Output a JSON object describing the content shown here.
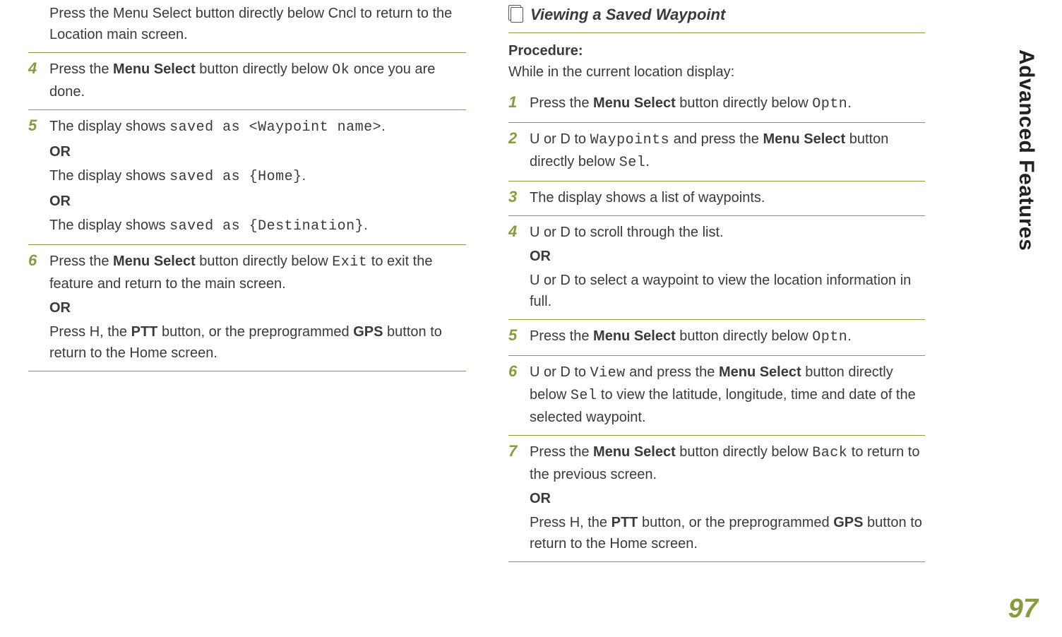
{
  "sideTab": "Advanced Features",
  "pageNumber": "97",
  "left": {
    "intro": {
      "pre": "Press the ",
      "b1": "Menu Select",
      "mid1": " button directly below ",
      "m1": "Cncl",
      "post": " to return to the Location main screen."
    },
    "s4": {
      "num": "4",
      "pre": "Press the ",
      "b1": "Menu Select",
      "mid1": " button directly below ",
      "m1": "Ok",
      "post": " once you are done."
    },
    "s5": {
      "num": "5",
      "l1a": "The display shows ",
      "l1m": "saved as <Waypoint name>",
      "l1b": ".",
      "or1": "OR",
      "l2a": "The display shows ",
      "l2m": "saved as {Home}",
      "l2b": ".",
      "or2": "OR",
      "l3a": "The display shows ",
      "l3m": "saved as {Destination}",
      "l3b": "."
    },
    "s6": {
      "num": "6",
      "pre": "Press the ",
      "b1": "Menu Select",
      "mid1": " button directly below ",
      "m1": "Exit",
      "post": " to exit the feature and return to the main screen.",
      "or": "OR",
      "l2a": "Press ",
      "l2h": "H",
      "l2b": ", the ",
      "l2ptt": "PTT",
      "l2c": " button, or the preprogrammed ",
      "l2gps": "GPS",
      "l2d": " button to return to the Home screen."
    }
  },
  "right": {
    "heading": "Viewing a Saved Waypoint",
    "procLabel": "Procedure:",
    "procText": "While in the current location display:",
    "s1": {
      "num": "1",
      "pre": "Press the ",
      "b1": "Menu Select",
      "mid1": " button directly below ",
      "m1": "Optn",
      "post": "."
    },
    "s2": {
      "num": "2",
      "u": "U",
      "or": " or ",
      "d": "D",
      "mid1": " to ",
      "m1": "Waypoints",
      "mid2": " and press the ",
      "b1": "Menu Select",
      "mid3": " button directly below ",
      "m2": "Sel",
      "post": "."
    },
    "s3": {
      "num": "3",
      "text": "The display shows a list of waypoints."
    },
    "s4": {
      "num": "4",
      "u1": "U",
      "or1": " or ",
      "d1": "D",
      "t1": " to scroll through the list.",
      "orL": "OR",
      "u2": "U",
      "or2": " or ",
      "d2": "D",
      "t2": " to select a waypoint to view the location information in full."
    },
    "s5": {
      "num": "5",
      "pre": "Press the ",
      "b1": "Menu Select",
      "mid1": " button directly below ",
      "m1": "Optn",
      "post": "."
    },
    "s6": {
      "num": "6",
      "u": "U",
      "or": " or ",
      "d": "D",
      "mid1": " to ",
      "m1": "View",
      "mid2": " and press the ",
      "b1": "Menu Select",
      "mid3": " button directly below ",
      "m2": "Sel",
      "post": " to view the latitude, longitude, time and date of the selected waypoint."
    },
    "s7": {
      "num": "7",
      "pre": "Press the ",
      "b1": "Menu Select",
      "mid1": " button directly below ",
      "m1": "Back",
      "post": " to return to the previous screen.",
      "orL": "OR",
      "l2a": "Press ",
      "l2h": "H",
      "l2b": ", the ",
      "l2ptt": "PTT",
      "l2c": " button, or the preprogrammed ",
      "l2gps": "GPS",
      "l2d": " button to return to the Home screen."
    }
  }
}
